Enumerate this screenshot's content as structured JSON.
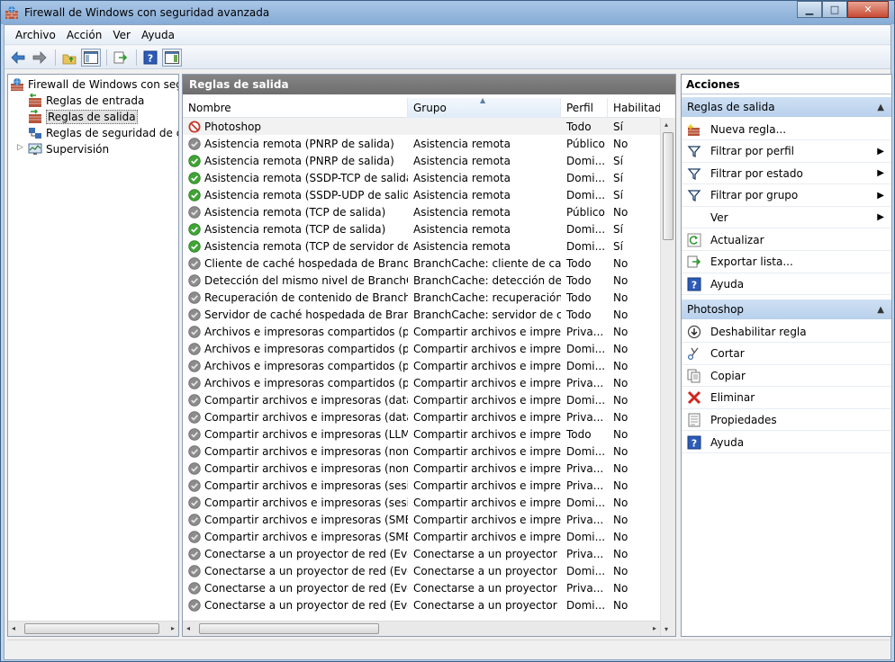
{
  "window": {
    "title": "Firewall de Windows con seguridad avanzada"
  },
  "menu": [
    "Archivo",
    "Acción",
    "Ver",
    "Ayuda"
  ],
  "tree": {
    "root": "Firewall de Windows con segur",
    "items": [
      "Reglas de entrada",
      "Reglas de salida",
      "Reglas de seguridad de con",
      "Supervisión"
    ]
  },
  "center": {
    "header": "Reglas de salida",
    "columns": {
      "name": "Nombre",
      "group": "Grupo",
      "profile": "Perfil",
      "enabled": "Habilitado"
    },
    "rows": [
      {
        "status": "blocked",
        "name": "Photoshop",
        "group": "",
        "profile": "Todo",
        "enabled": "Sí"
      },
      {
        "status": "disabled",
        "name": "Asistencia remota (PNRP de salida)",
        "group": "Asistencia remota",
        "profile": "Público",
        "enabled": "No"
      },
      {
        "status": "allowed",
        "name": "Asistencia remota (PNRP de salida)",
        "group": "Asistencia remota",
        "profile": "Domi...",
        "enabled": "Sí"
      },
      {
        "status": "allowed",
        "name": "Asistencia remota (SSDP-TCP de salida)",
        "group": "Asistencia remota",
        "profile": "Domi...",
        "enabled": "Sí"
      },
      {
        "status": "allowed",
        "name": "Asistencia remota (SSDP-UDP de salida)",
        "group": "Asistencia remota",
        "profile": "Domi...",
        "enabled": "Sí"
      },
      {
        "status": "disabled",
        "name": "Asistencia remota (TCP de salida)",
        "group": "Asistencia remota",
        "profile": "Público",
        "enabled": "No"
      },
      {
        "status": "allowed",
        "name": "Asistencia remota (TCP de salida)",
        "group": "Asistencia remota",
        "profile": "Domi...",
        "enabled": "Sí"
      },
      {
        "status": "allowed",
        "name": "Asistencia remota (TCP de servidor de R...",
        "group": "Asistencia remota",
        "profile": "Domi...",
        "enabled": "Sí"
      },
      {
        "status": "disabled",
        "name": "Cliente de caché hospedada de BranchC...",
        "group": "BranchCache: cliente de cac...",
        "profile": "Todo",
        "enabled": "No"
      },
      {
        "status": "disabled",
        "name": "Detección del mismo nivel de BranchCac...",
        "group": "BranchCache: detección del...",
        "profile": "Todo",
        "enabled": "No"
      },
      {
        "status": "disabled",
        "name": "Recuperación de contenido de BranchCa...",
        "group": "BranchCache: recuperación ...",
        "profile": "Todo",
        "enabled": "No"
      },
      {
        "status": "disabled",
        "name": "Servidor de caché hospedada de Branch...",
        "group": "BranchCache: servidor de ca...",
        "profile": "Todo",
        "enabled": "No"
      },
      {
        "status": "disabled",
        "name": "Archivos e impresoras compartidos (peti...",
        "group": "Compartir archivos e impres...",
        "profile": "Priva...",
        "enabled": "No"
      },
      {
        "status": "disabled",
        "name": "Archivos e impresoras compartidos (peti...",
        "group": "Compartir archivos e impres...",
        "profile": "Domi...",
        "enabled": "No"
      },
      {
        "status": "disabled",
        "name": "Archivos e impresoras compartidos (peti...",
        "group": "Compartir archivos e impres...",
        "profile": "Domi...",
        "enabled": "No"
      },
      {
        "status": "disabled",
        "name": "Archivos e impresoras compartidos (peti...",
        "group": "Compartir archivos e impres...",
        "profile": "Priva...",
        "enabled": "No"
      },
      {
        "status": "disabled",
        "name": "Compartir archivos e impresoras (datagr...",
        "group": "Compartir archivos e impres...",
        "profile": "Domi...",
        "enabled": "No"
      },
      {
        "status": "disabled",
        "name": "Compartir archivos e impresoras (datagr...",
        "group": "Compartir archivos e impres...",
        "profile": "Priva...",
        "enabled": "No"
      },
      {
        "status": "disabled",
        "name": "Compartir archivos e impresoras (LLMNR...",
        "group": "Compartir archivos e impres...",
        "profile": "Todo",
        "enabled": "No"
      },
      {
        "status": "disabled",
        "name": "Compartir archivos e impresoras (nombr...",
        "group": "Compartir archivos e impres...",
        "profile": "Domi...",
        "enabled": "No"
      },
      {
        "status": "disabled",
        "name": "Compartir archivos e impresoras (nombr...",
        "group": "Compartir archivos e impres...",
        "profile": "Priva...",
        "enabled": "No"
      },
      {
        "status": "disabled",
        "name": "Compartir archivos e impresoras (sesión ...",
        "group": "Compartir archivos e impres...",
        "profile": "Priva...",
        "enabled": "No"
      },
      {
        "status": "disabled",
        "name": "Compartir archivos e impresoras (sesión ...",
        "group": "Compartir archivos e impres...",
        "profile": "Domi...",
        "enabled": "No"
      },
      {
        "status": "disabled",
        "name": "Compartir archivos e impresoras (SMB d...",
        "group": "Compartir archivos e impres...",
        "profile": "Priva...",
        "enabled": "No"
      },
      {
        "status": "disabled",
        "name": "Compartir archivos e impresoras (SMB d...",
        "group": "Compartir archivos e impres...",
        "profile": "Domi...",
        "enabled": "No"
      },
      {
        "status": "disabled",
        "name": "Conectarse a un proyector de red (Event...",
        "group": "Conectarse a un proyector d...",
        "profile": "Priva...",
        "enabled": "No"
      },
      {
        "status": "disabled",
        "name": "Conectarse a un proyector de red (Event...",
        "group": "Conectarse a un proyector d...",
        "profile": "Domi...",
        "enabled": "No"
      },
      {
        "status": "disabled",
        "name": "Conectarse a un proyector de red (Event...",
        "group": "Conectarse a un proyector d...",
        "profile": "Priva...",
        "enabled": "No"
      },
      {
        "status": "disabled",
        "name": "Conectarse a un proyector de red (Event...",
        "group": "Conectarse a un proyector d...",
        "profile": "Domi...",
        "enabled": "No"
      }
    ]
  },
  "actions": {
    "title": "Acciones",
    "section1": "Reglas de salida",
    "section1_items": [
      {
        "label": "Nueva regla...",
        "icon": "new-rule-icon",
        "submenu": false
      },
      {
        "label": "Filtrar por perfil",
        "icon": "filter-icon",
        "submenu": true
      },
      {
        "label": "Filtrar por estado",
        "icon": "filter-icon",
        "submenu": true
      },
      {
        "label": "Filtrar por grupo",
        "icon": "filter-icon",
        "submenu": true
      },
      {
        "label": "Ver",
        "icon": "",
        "submenu": true
      },
      {
        "label": "Actualizar",
        "icon": "refresh-icon",
        "submenu": false
      },
      {
        "label": "Exportar lista...",
        "icon": "export-icon",
        "submenu": false
      },
      {
        "label": "Ayuda",
        "icon": "help-icon",
        "submenu": false
      }
    ],
    "section2": "Photoshop",
    "section2_items": [
      {
        "label": "Deshabilitar regla",
        "icon": "disable-icon"
      },
      {
        "label": "Cortar",
        "icon": "cut-icon"
      },
      {
        "label": "Copiar",
        "icon": "copy-icon"
      },
      {
        "label": "Eliminar",
        "icon": "delete-icon"
      },
      {
        "label": "Propiedades",
        "icon": "properties-icon"
      },
      {
        "label": "Ayuda",
        "icon": "help-icon"
      }
    ]
  },
  "colors": {
    "allowed": "#3fa535",
    "disabled": "#8c8c8c",
    "blocked": "#c0392b",
    "header": "#7a7a7a"
  }
}
